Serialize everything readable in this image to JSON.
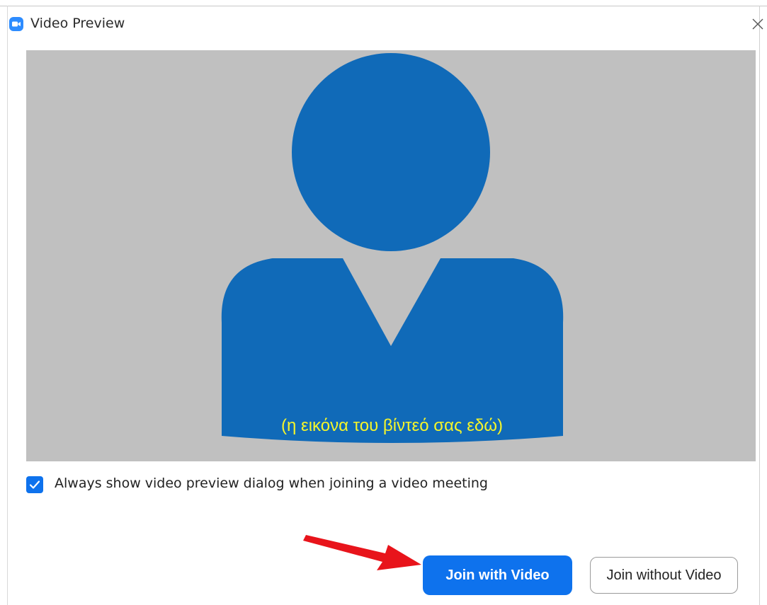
{
  "window": {
    "title": "Video Preview",
    "app_icon": "zoom-camera-icon",
    "close_icon": "close-icon"
  },
  "preview": {
    "caption": "(η εικόνα του βίντεό σας εδώ)",
    "placeholder_icon": "person-silhouette-icon"
  },
  "options": {
    "always_show_label": "Always show video preview dialog when joining a video meeting",
    "always_show_checked": true
  },
  "buttons": {
    "join_with_video": "Join with Video",
    "join_without_video": "Join without Video"
  },
  "annotation": {
    "arrow_icon": "red-arrow-icon"
  },
  "colors": {
    "accent": "#0e72ed",
    "preview_background": "#c0c0c0",
    "silhouette": "#106ab8",
    "caption": "#f5f52a",
    "arrow": "#e8141b"
  }
}
